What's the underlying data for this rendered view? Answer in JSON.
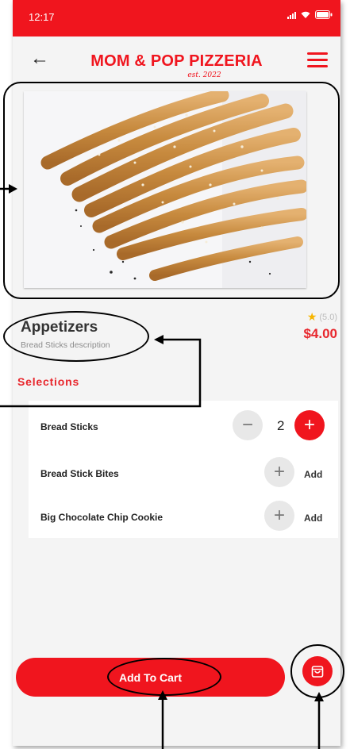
{
  "status_bar": {
    "time": "12:17"
  },
  "header": {
    "back_icon": "back-arrow-icon",
    "brand": "MOM & POP PIZZERIA",
    "brand_tagline": "est. 2022",
    "menu_icon": "hamburger-menu-icon"
  },
  "product": {
    "image": "bread-sticks-photo",
    "title": "Appetizers",
    "description": "Bread Sticks description",
    "rating": "(5.0)",
    "price": "$4.00"
  },
  "selections": {
    "title": "Selections",
    "items": [
      {
        "name": "Bread Sticks",
        "quantity": "2"
      },
      {
        "name": "Bread Stick Bites",
        "action": "Add"
      },
      {
        "name": "Big Chocolate Chip Cookie",
        "action": "Add"
      }
    ]
  },
  "footer": {
    "add_to_cart": "Add To Cart",
    "cart_icon": "shopping-bag-icon"
  },
  "colors": {
    "accent": "#f0151e",
    "price": "#e8262c",
    "star": "#f7b500"
  }
}
